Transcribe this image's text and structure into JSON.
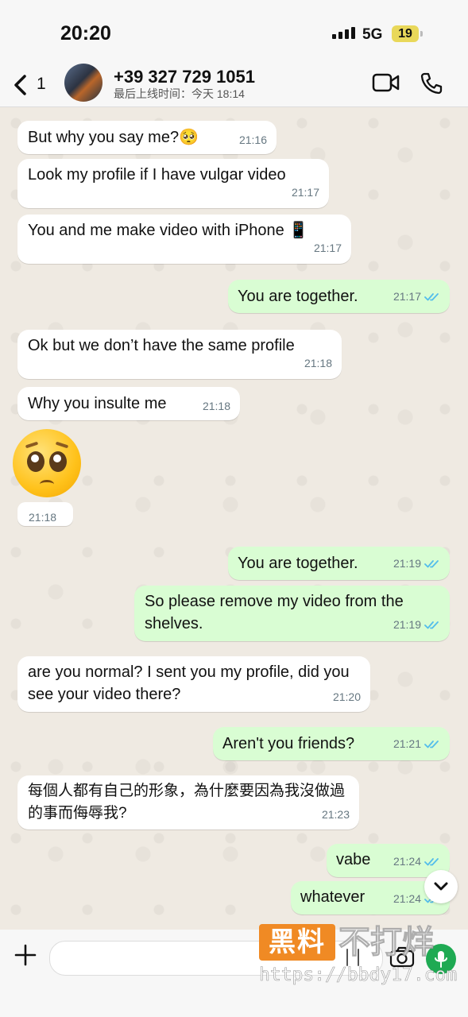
{
  "status_bar": {
    "time": "20:20",
    "network": "5G",
    "battery": "19"
  },
  "header": {
    "back_count": "1",
    "contact_name": "+39 327 729 1051",
    "contact_status": "最后上线时间：今天 18:14"
  },
  "messages": [
    {
      "dir": "in",
      "text": "But why you say me?🥺",
      "time": "21:16"
    },
    {
      "dir": "in",
      "text": "Look my profile if I have vulgar video",
      "time": "21:17"
    },
    {
      "dir": "in",
      "text": "You and me make video with iPhone 📱",
      "time": "21:17"
    },
    {
      "dir": "out",
      "text": "You are together.",
      "time": "21:17"
    },
    {
      "dir": "in",
      "text": "Ok but we don’t have the same profile",
      "time": "21:18"
    },
    {
      "dir": "in",
      "text": "Why you insulte me",
      "time": "21:18"
    },
    {
      "dir": "in",
      "text": "",
      "time": "21:18",
      "emoji": "pleading-face"
    },
    {
      "dir": "out",
      "text": "You are together.",
      "time": "21:19"
    },
    {
      "dir": "out",
      "text": "So please remove my video from the shelves.",
      "time": "21:19"
    },
    {
      "dir": "in",
      "text": "are you normal? I sent you my profile, did you see your video there?",
      "time": "21:20"
    },
    {
      "dir": "out",
      "text": "Aren't you friends?",
      "time": "21:21"
    },
    {
      "dir": "in",
      "text": "每個人都有自己的形象，為什麼要因為我沒做過的事而侮辱我?",
      "time": "21:23"
    },
    {
      "dir": "out",
      "text": "vabe",
      "time": "21:24"
    },
    {
      "dir": "out",
      "text": "whatever",
      "time": "21:24"
    }
  ],
  "input": {
    "placeholder": ""
  },
  "watermark": {
    "brand": "黑料",
    "text": "不打烊",
    "url": "https://bbdy17.com"
  },
  "colors": {
    "incoming": "#ffffff",
    "outgoing": "#d9fdd3",
    "read_ticks": "#53bdeb",
    "accent": "#1faa53",
    "background": "#efeae2"
  },
  "icons": [
    "chevron-left-icon",
    "video-call-icon",
    "phone-icon",
    "plus-icon",
    "sticker-icon",
    "camera-icon",
    "mic-icon",
    "chevron-down-icon",
    "double-check-icon"
  ]
}
